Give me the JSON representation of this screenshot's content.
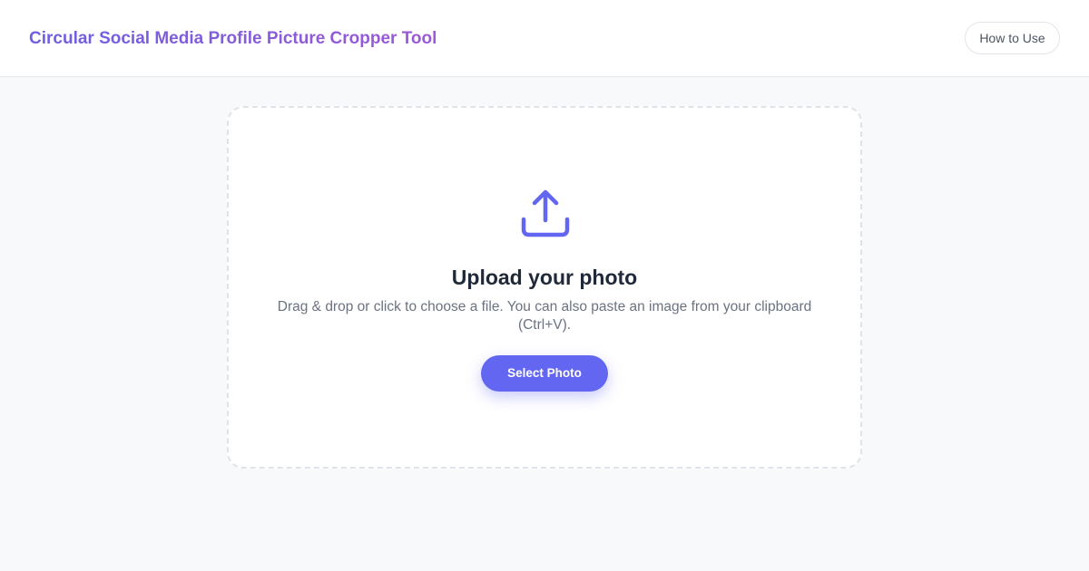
{
  "header": {
    "title": "Circular Social Media Profile Picture Cropper Tool",
    "how_to_use_label": "How to Use"
  },
  "upload": {
    "icon": "upload-icon",
    "title": "Upload your photo",
    "description": "Drag & drop or click to choose a file. You can also paste an image from your clipboard (Ctrl+V).",
    "select_button_label": "Select Photo"
  },
  "colors": {
    "accent": "#6366f1",
    "title_gradient_start": "#6d5fe0",
    "title_gradient_end": "#9b59d6",
    "background": "#f8f9fb"
  }
}
